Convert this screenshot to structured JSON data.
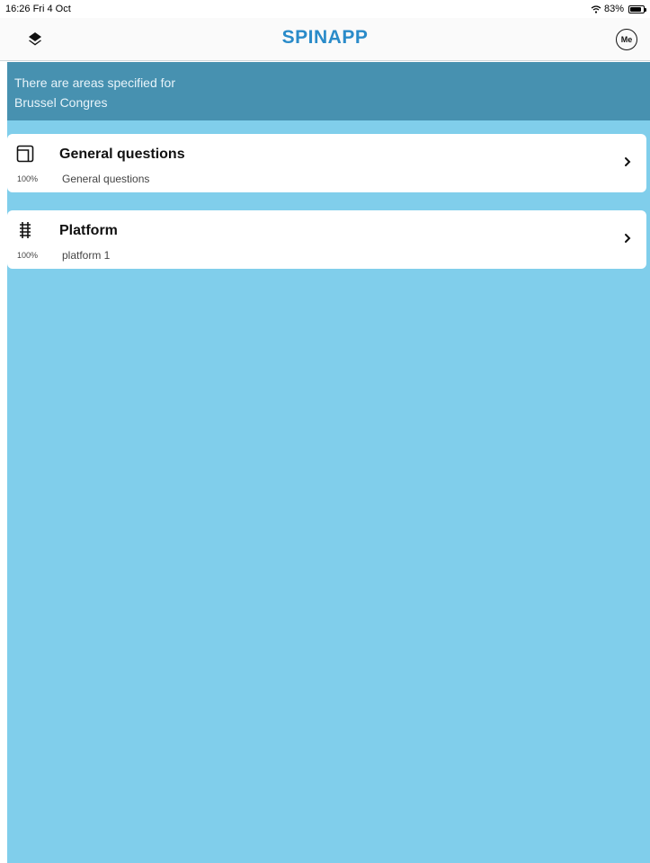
{
  "status_bar": {
    "time_date": "16:26  Fri 4 Oct",
    "battery": "83%",
    "battery_level": 0.83
  },
  "nav": {
    "title": "SPINAPP",
    "me_label": "Me"
  },
  "banner": {
    "line1": "There are areas specified for",
    "line2": "Brussel Congres"
  },
  "items": [
    {
      "icon": "area-icon",
      "title": "General questions",
      "percent": "100%",
      "subtitle": "General questions"
    },
    {
      "icon": "track-icon",
      "title": "Platform",
      "percent": "100%",
      "subtitle": "platform 1"
    }
  ],
  "colors": {
    "page_background": "#80CEEB",
    "banner_background": "#4791B0",
    "title_blue": "#2A8BC9",
    "card": "#FFFFFF"
  }
}
